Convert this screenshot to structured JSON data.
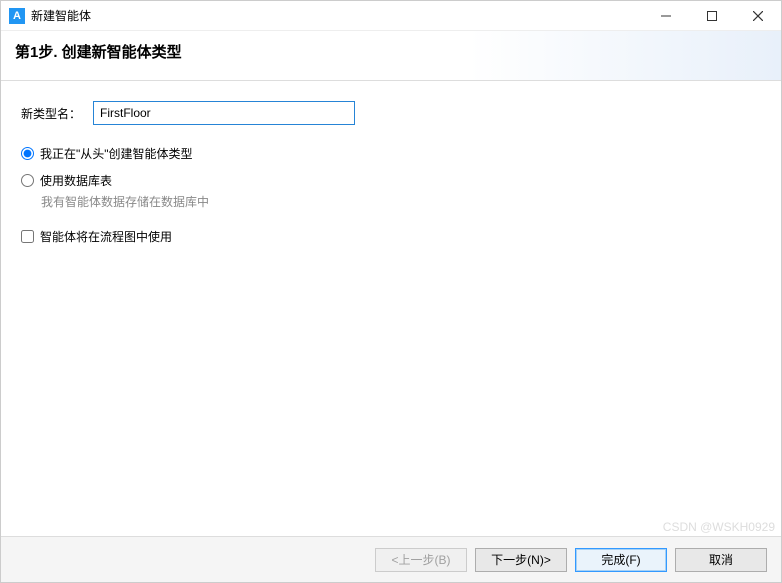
{
  "window": {
    "title": "新建智能体"
  },
  "header": {
    "step_title": "第1步. 创建新智能体类型"
  },
  "form": {
    "name_label": "新类型名：",
    "name_value": "FirstFloor",
    "radio_from_scratch": "我正在\"从头\"创建智能体类型",
    "radio_use_db": "使用数据库表",
    "db_hint": "我有智能体数据存储在数据库中",
    "checkbox_flow": "智能体将在流程图中使用"
  },
  "buttons": {
    "back": "<上一步(B)",
    "next": "下一步(N)>",
    "finish": "完成(F)",
    "cancel": "取消"
  },
  "watermark": "CSDN @WSKH0929"
}
